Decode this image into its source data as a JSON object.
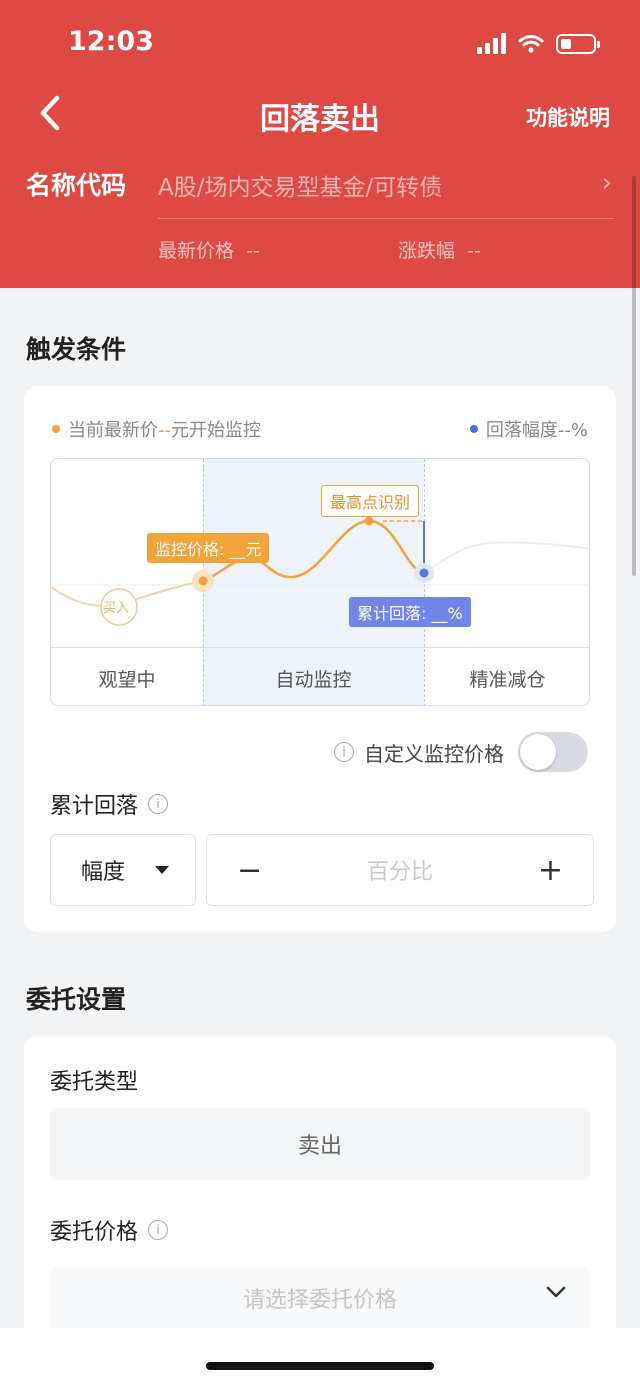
{
  "status_bar": {
    "time": "12:03"
  },
  "nav": {
    "title": "回落卖出",
    "help_link": "功能说明"
  },
  "stock": {
    "name_label": "名称代码",
    "placeholder": "A股/场内交易型基金/可转债",
    "latest_price_label": "最新价格",
    "latest_price_value": "--",
    "change_label": "涨跌幅",
    "change_value": "--"
  },
  "trigger": {
    "section_title": "触发条件",
    "legend_left_prefix": "当前最新价",
    "legend_left_value": "--",
    "legend_left_suffix": "元开始监控",
    "legend_right_prefix": "回落幅度",
    "legend_right_value": "--%",
    "diagram": {
      "tag_buy": "买入",
      "tag_monitor_price": "监控价格: __元",
      "tag_high_point": "最高点识别",
      "tag_cumulative_drop": "累计回落: __%",
      "zone_watch": "观望中",
      "zone_auto": "自动监控",
      "zone_close": "精准减仓"
    },
    "custom_price_label": "自定义监控价格",
    "custom_price_enabled": false,
    "cumulative_label": "累计回落",
    "mode_select": "幅度",
    "stepper_minus": "−",
    "stepper_placeholder": "百分比",
    "stepper_plus": "+"
  },
  "order": {
    "section_title": "委托设置",
    "type_label": "委托类型",
    "type_value": "卖出",
    "price_label": "委托价格",
    "price_placeholder": "请选择委托价格"
  },
  "colors": {
    "header_red": "#de4a43",
    "accent_orange": "#f2a33a",
    "accent_blue": "#6f86e8"
  }
}
